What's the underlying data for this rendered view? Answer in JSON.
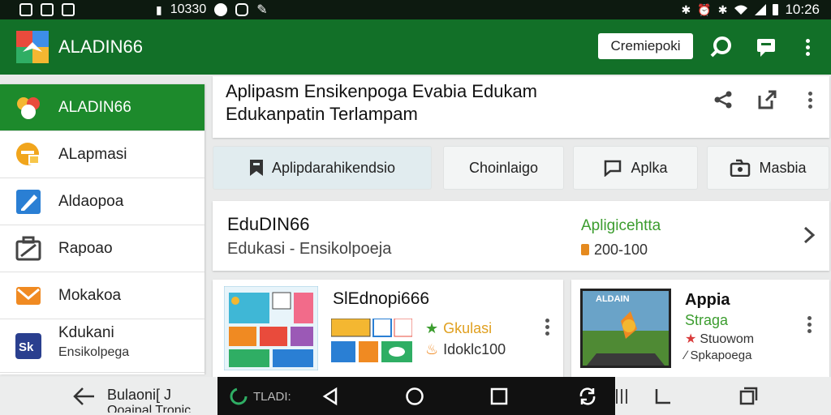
{
  "status_bar": {
    "time_left": "10330",
    "time_right": "10:26",
    "left_icons": [
      "image-icon",
      "gallery-icon",
      "file-icon",
      "notification-icon",
      "camera-icon",
      "chat-icon",
      "edit-icon"
    ],
    "right_icons": [
      "bluetooth-icon",
      "alarm-icon",
      "bluetooth-icon",
      "wifi-icon",
      "signal-icon",
      "battery-icon"
    ]
  },
  "app_bar": {
    "title": "ALADIN66",
    "action_button": "Cremiepoki",
    "icons": [
      "search-icon",
      "message-icon",
      "more-vert-icon"
    ],
    "color": "#127028"
  },
  "sidebar": {
    "items": [
      {
        "label": "ALADIN66",
        "icon": "app-logo-icon",
        "active": true
      },
      {
        "label": "ALapmasi",
        "icon": "chat-icon",
        "active": false
      },
      {
        "label": "Aldaopoa",
        "icon": "edit-icon",
        "active": false
      },
      {
        "label": "Rapoao",
        "icon": "briefcase-icon",
        "active": false
      },
      {
        "label": "Mokakoa",
        "icon": "mail-icon",
        "active": false
      },
      {
        "label": "Kdukani",
        "sublabel": "Ensikolpega",
        "icon": "sk-icon",
        "active": false
      }
    ],
    "active_color": "#1d8a2c"
  },
  "header": {
    "title_line1": "Aplipasm Ensikenpoga Evabia Edukam",
    "title_line2": "Edukanpatin Terlampam",
    "icons": [
      "share-icon",
      "open-external-icon",
      "more-vert-icon"
    ]
  },
  "chips": [
    {
      "label": "Aplipdarahikendsio",
      "icon": "bookmark-icon",
      "selected": true
    },
    {
      "label": "Choinlaigo",
      "icon": "",
      "selected": false
    },
    {
      "label": "Aplka",
      "icon": "comment-icon",
      "selected": false
    },
    {
      "label": "Masbia",
      "icon": "media-icon",
      "selected": false
    }
  ],
  "featured": {
    "title": "EduDIN66",
    "subtitle": "Edukasi - Ensikolpoeja",
    "tag": "Apligicehtta",
    "count": "200-100",
    "tag_color": "#3c9d2f"
  },
  "app_cards": [
    {
      "title": "SlEdnopi666",
      "line1": "Gkulasi",
      "line2": "Idoklc100",
      "line1_color": "#e0a020"
    },
    {
      "title": "Appia",
      "thumb_text": "ALDAIN",
      "line1": "Straga",
      "line2": "Stuowom",
      "line3": "Spkapoega",
      "line1_color": "#3c9d2f"
    }
  ],
  "bottom_nav": {
    "back_label_line1": "Bulaoni[ J",
    "back_label_line2": "Ooaipal Tronic",
    "mini_label": "TLADI:",
    "icons": [
      "back-icon",
      "home-icon",
      "recents-icon",
      "rotate-icon",
      "menu-icon",
      "crop-icon",
      "square-icon"
    ]
  }
}
